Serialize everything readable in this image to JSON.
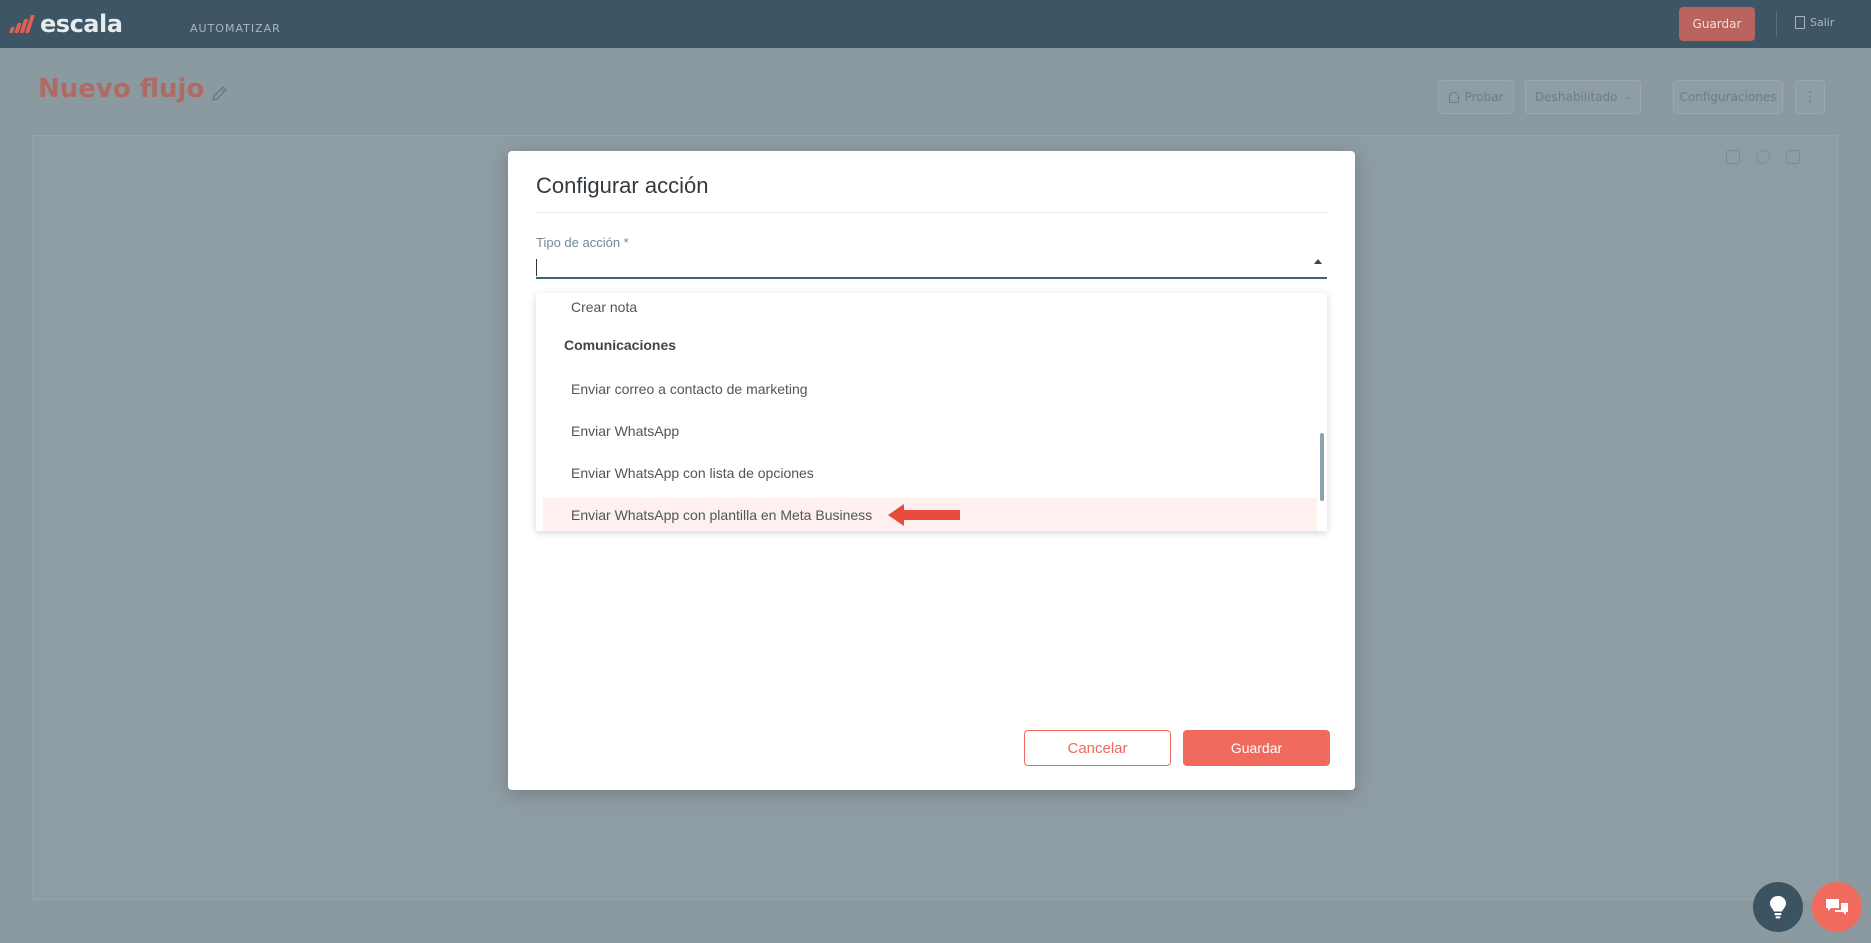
{
  "app": {
    "brand": "escala",
    "nav_label": "AUTOMATIZAR",
    "save_label": "Guardar",
    "exit_label": "Salir"
  },
  "page": {
    "title": "Nuevo flujo",
    "buttons": {
      "test": "Probar",
      "status": "Deshabilitado",
      "settings": "Configuraciones"
    }
  },
  "modal": {
    "title": "Configurar acción",
    "field_label": "Tipo de acción *",
    "field_value": "",
    "dropdown": {
      "items": [
        {
          "label": "Crear nota",
          "type": "option"
        },
        {
          "label": "Comunicaciones",
          "type": "group"
        },
        {
          "label": "Enviar correo a contacto de marketing",
          "type": "option"
        },
        {
          "label": "Enviar WhatsApp",
          "type": "option"
        },
        {
          "label": "Enviar WhatsApp con lista de opciones",
          "type": "option"
        },
        {
          "label": "Enviar WhatsApp con plantilla en Meta Business",
          "type": "option",
          "highlighted": true
        }
      ]
    },
    "cancel_label": "Cancelar",
    "save_label": "Guardar"
  },
  "colors": {
    "accent": "#f06a5d",
    "topbar": "#3e5566",
    "overlay": "#8b9aa1",
    "highlight_row": "#fdf0ee",
    "arrow": "#e84a3b"
  },
  "icons": {
    "pencil": "pencil-icon",
    "chevron": "chevron-up-icon",
    "idea": "lightbulb-icon",
    "chat": "chat-icon"
  }
}
